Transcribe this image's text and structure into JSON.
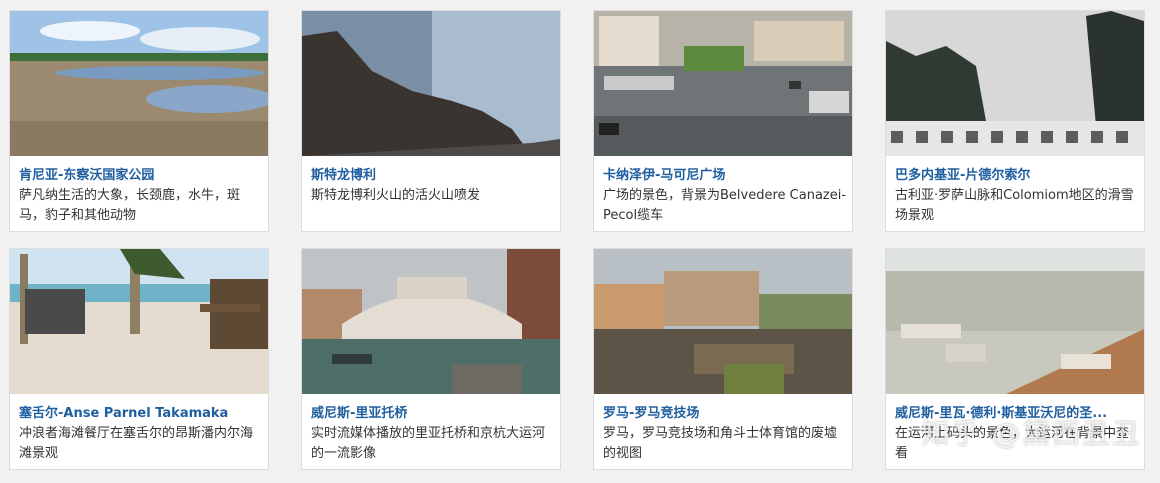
{
  "cards": [
    {
      "title": "肯尼亚-东察沃国家公园",
      "desc": "萨凡纳生活的大象，长颈鹿，水牛，斑马，豹子和其他动物"
    },
    {
      "title": "斯特龙博利",
      "desc": "斯特龙博利火山的活火山喷发"
    },
    {
      "title": "卡纳泽伊-马可尼广场",
      "desc": "广场的景色，背景为Belvedere Canazei-Pecol缆车"
    },
    {
      "title": "巴多内基亚-片德尔索尔",
      "desc": "古利亚·罗萨山脉和Colomiom地区的滑雪场景观"
    },
    {
      "title": "塞舌尔-Anse Parnel Takamaka",
      "desc": "冲浪者海滩餐厅在塞舌尔的昂斯潘内尔海滩景观"
    },
    {
      "title": "威尼斯-里亚托桥",
      "desc": "实时流媒体播放的里亚托桥和京杭大运河的一流影像"
    },
    {
      "title": "罗马-罗马竞技场",
      "desc": "罗马，罗马竞技场和角斗士体育馆的废墟的视图"
    },
    {
      "title": "威尼斯-里瓦·德利·斯基亚沃尼的圣...",
      "desc": "在运河上码头的景色，大运河在背景中查看"
    }
  ],
  "watermark": "知乎 @黛西丑丑",
  "colors": {
    "title": "#1f5fa0",
    "text": "#333333",
    "background": "#f1f1f1"
  }
}
